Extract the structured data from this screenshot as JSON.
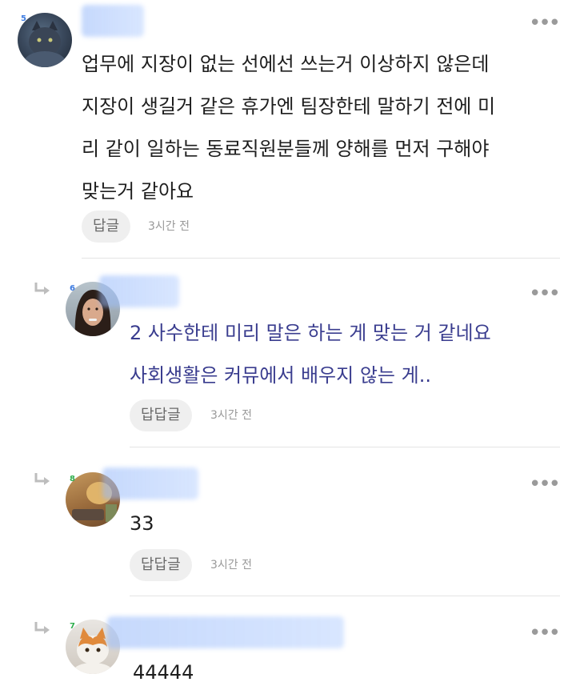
{
  "comments": [
    {
      "level_badge": "5",
      "text": "업무에 지장이 없는 선에선 쓰는거 이상하지 않은데\n지장이 생길거 같은 휴가엔 팀장한테 말하기 전에 미\n리 같이 일하는 동료직원분들께 양해를 먼저 구해야\n맞는거 같아요",
      "reply_label": "답글",
      "time": "3시간 전"
    },
    {
      "level_badge": "6",
      "text": "2 사수한테 미리 말은 하는 게 맞는 거 같네요\n사회생활은 커뮤에서 배우지 않는 게..",
      "reply_label": "답답글",
      "time": "3시간 전"
    },
    {
      "level_badge": "8",
      "text": "33",
      "reply_label": "답답글",
      "time": "3시간 전"
    },
    {
      "level_badge": "7",
      "text": "44444"
    }
  ],
  "colors": {
    "reply_text": "#3a3d8f",
    "name_blur": "#9cbcf8",
    "button_bg": "#efefef"
  },
  "icons": [
    "reply-arrow-icon",
    "more-options-icon"
  ]
}
